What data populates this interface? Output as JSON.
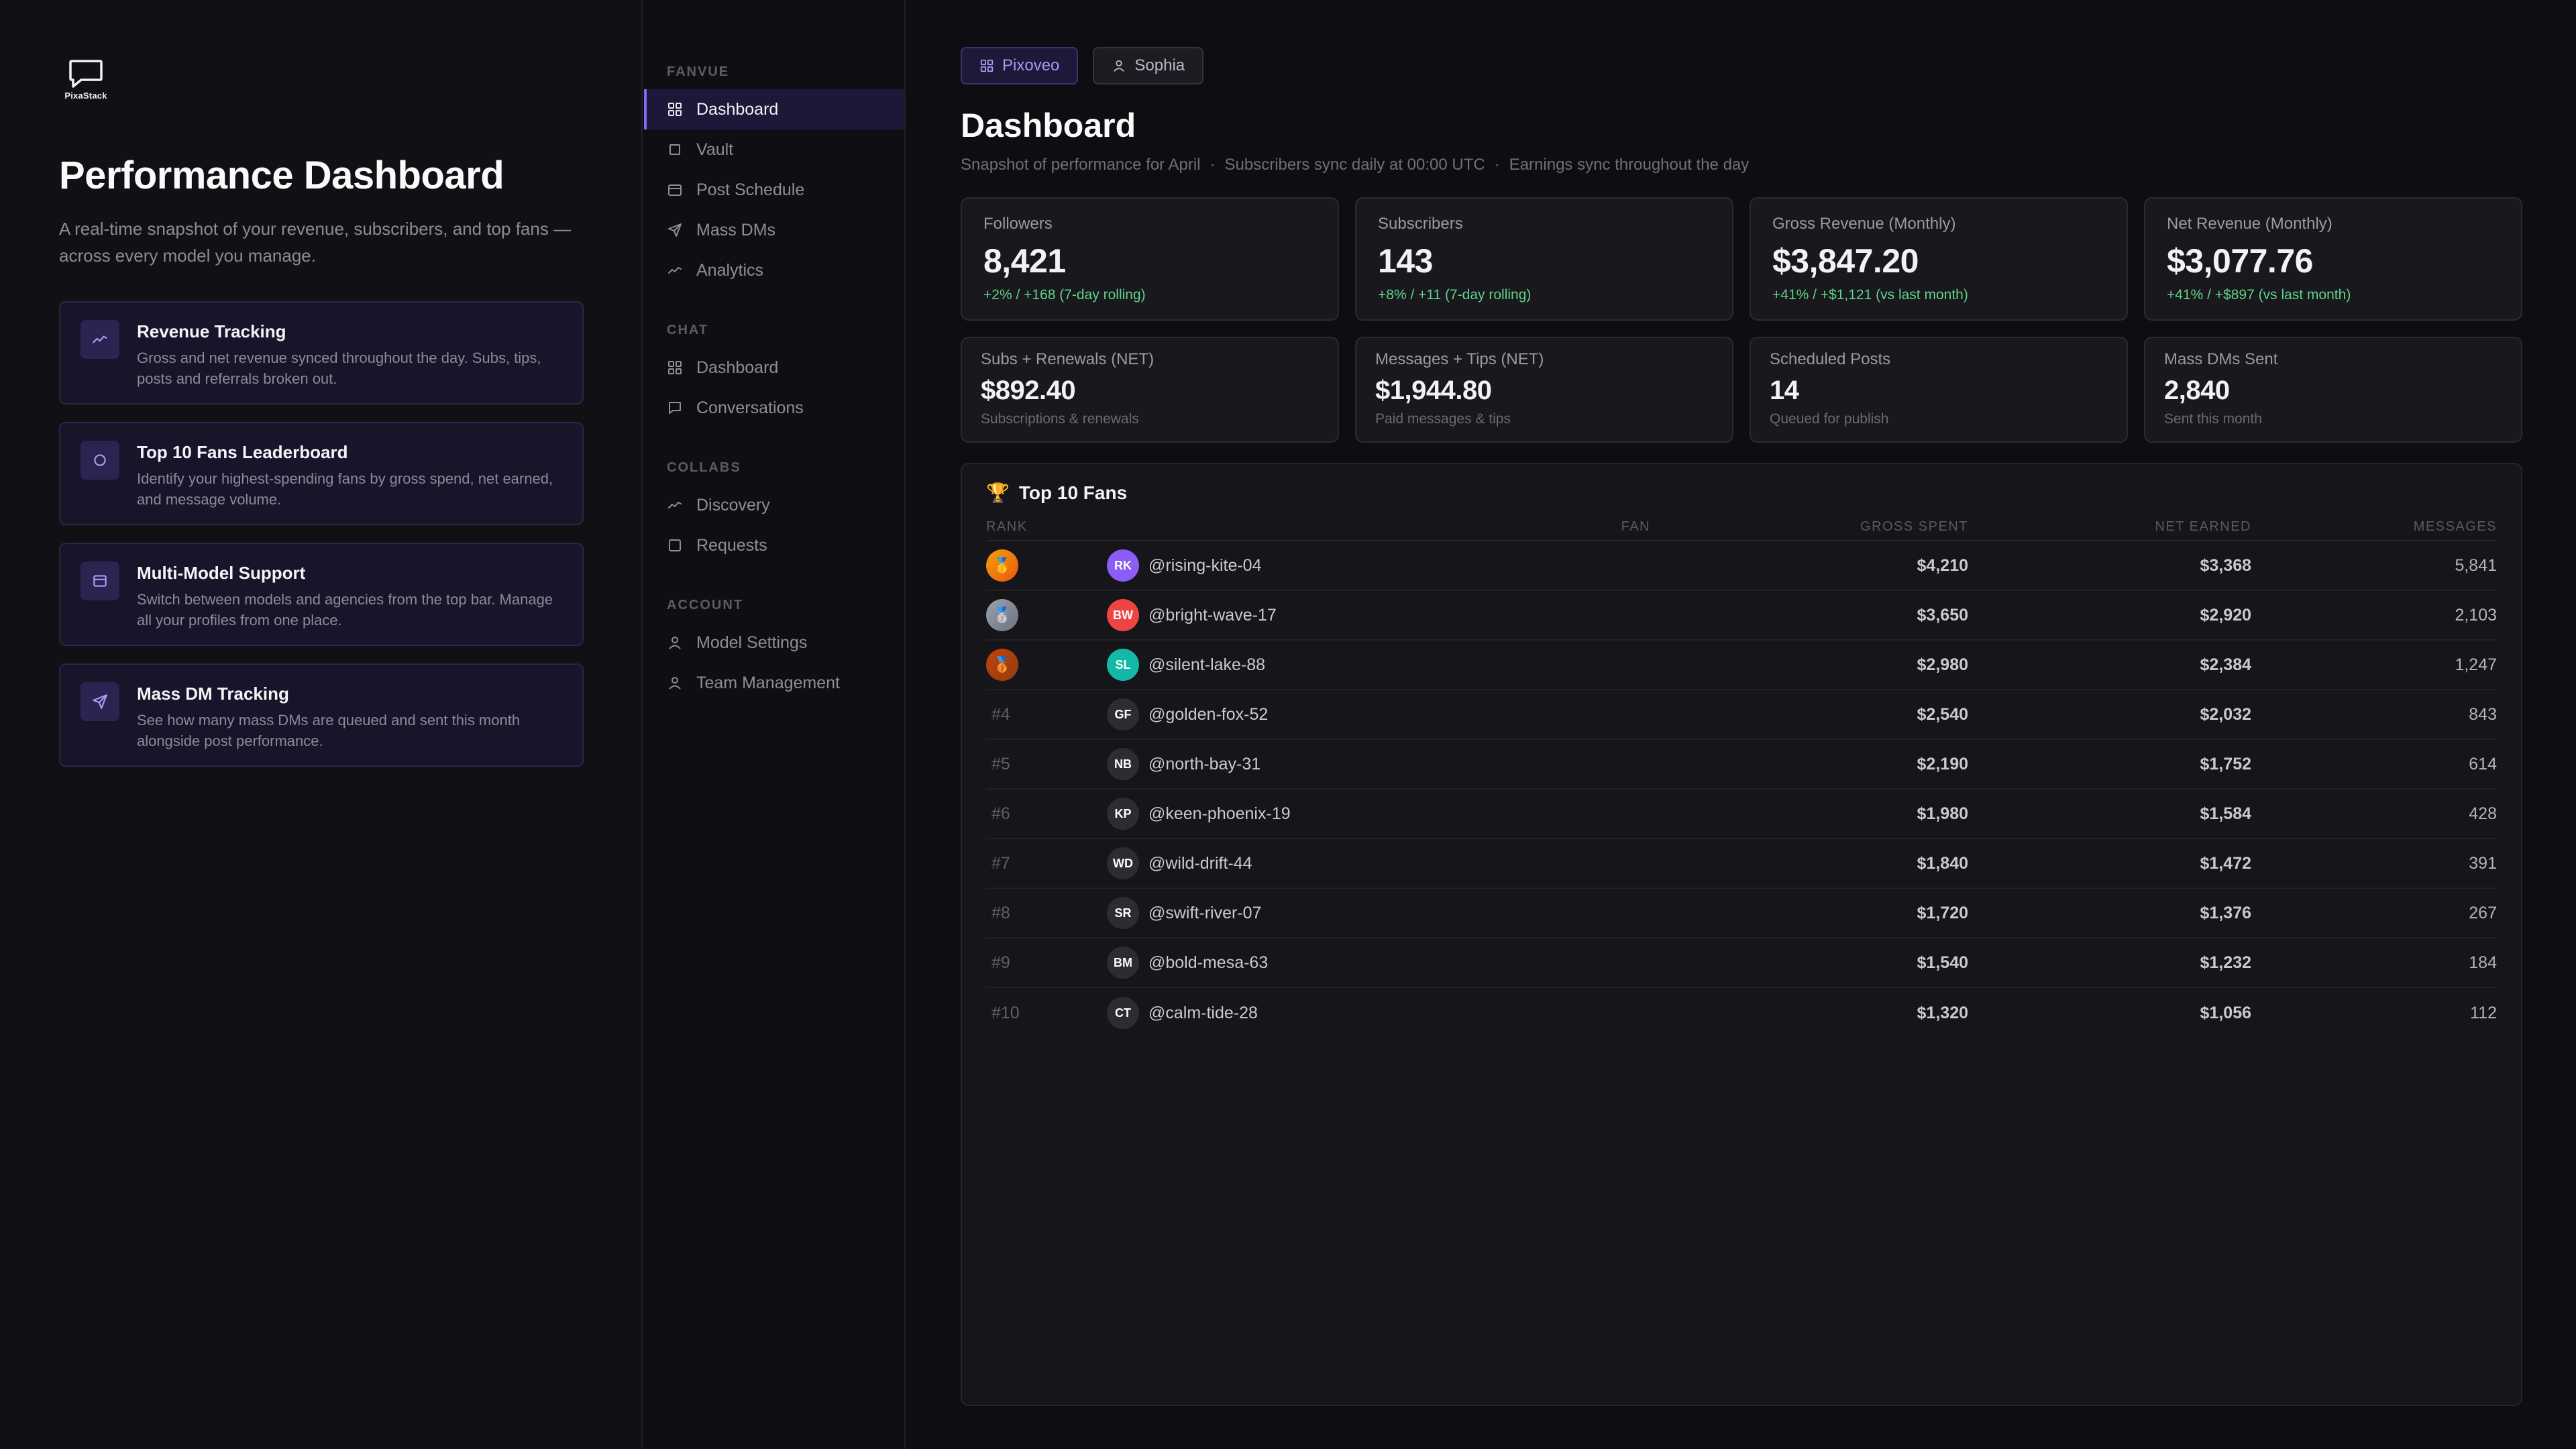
{
  "brand": {
    "name": "PixaStack"
  },
  "intro": {
    "title": "Performance Dashboard",
    "subtitle": "A real-time snapshot of your revenue, subscribers, and top fans — across every model you manage.",
    "features": [
      {
        "icon": "trend-icon",
        "title": "Revenue Tracking",
        "desc": "Gross and net revenue synced throughout the day. Subs, tips, posts and referrals broken out."
      },
      {
        "icon": "circle-icon",
        "title": "Top 10 Fans Leaderboard",
        "desc": "Identify your highest-spending fans by gross spend, net earned, and message volume."
      },
      {
        "icon": "window-icon",
        "title": "Multi-Model Support",
        "desc": "Switch between models and agencies from the top bar. Manage all your profiles from one place."
      },
      {
        "icon": "send-icon",
        "title": "Mass DM Tracking",
        "desc": "See how many mass DMs are queued and sent this month alongside post performance."
      }
    ]
  },
  "sidebar": {
    "sections": [
      {
        "heading": "FANVUE",
        "items": [
          {
            "label": "Dashboard",
            "icon": "grid-icon",
            "active": true
          },
          {
            "label": "Vault",
            "icon": "square-icon"
          },
          {
            "label": "Post Schedule",
            "icon": "calendar-icon"
          },
          {
            "label": "Mass DMs",
            "icon": "send-icon"
          },
          {
            "label": "Analytics",
            "icon": "trend-icon"
          }
        ]
      },
      {
        "heading": "CHAT",
        "items": [
          {
            "label": "Dashboard",
            "icon": "grid-icon"
          },
          {
            "label": "Conversations",
            "icon": "chat-icon"
          }
        ]
      },
      {
        "heading": "COLLABS",
        "items": [
          {
            "label": "Discovery",
            "icon": "trend-icon"
          },
          {
            "label": "Requests",
            "icon": "square-icon"
          }
        ]
      },
      {
        "heading": "ACCOUNT",
        "items": [
          {
            "label": "Model Settings",
            "icon": "user-icon"
          },
          {
            "label": "Team Management",
            "icon": "user-icon"
          }
        ]
      }
    ]
  },
  "topbar": {
    "org_label": "Pixoveo",
    "user_label": "Sophia"
  },
  "header": {
    "title": "Dashboard",
    "sub_1": "Snapshot of performance for April",
    "sub_2": "Subscribers sync daily at 00:00 UTC",
    "sub_3": "Earnings sync throughout the day",
    "separator": "·"
  },
  "stats_primary": [
    {
      "label": "Followers",
      "value": "8,421",
      "delta": "+2% / +168 (7-day rolling)"
    },
    {
      "label": "Subscribers",
      "value": "143",
      "delta": "+8% / +11 (7-day rolling)"
    },
    {
      "label": "Gross Revenue (Monthly)",
      "value": "$3,847.20",
      "delta": "+41% / +$1,121 (vs last month)"
    },
    {
      "label": "Net Revenue (Monthly)",
      "value": "$3,077.76",
      "delta": "+41% / +$897 (vs last month)"
    }
  ],
  "stats_secondary": [
    {
      "label": "Subs + Renewals (NET)",
      "value": "$892.40",
      "note": "Subscriptions & renewals"
    },
    {
      "label": "Messages + Tips (NET)",
      "value": "$1,944.80",
      "note": "Paid messages & tips"
    },
    {
      "label": "Scheduled Posts",
      "value": "14",
      "note": "Queued for publish"
    },
    {
      "label": "Mass DMs Sent",
      "value": "2,840",
      "note": "Sent this month"
    }
  ],
  "top_fans": {
    "title": "Top 10 Fans",
    "trophy": "🏆",
    "columns": {
      "rank": "RANK",
      "fan": "FAN",
      "gross": "GROSS SPENT",
      "net": "NET EARNED",
      "messages": "MESSAGES"
    },
    "rows": [
      {
        "rank": "#1",
        "medal": "gold",
        "medal_glyph": "🥇",
        "initials": "RK",
        "avatar_color": "#8b5cf6",
        "handle": "@rising-kite-04",
        "gross": "$4,210",
        "net": "$3,368",
        "messages": "5,841"
      },
      {
        "rank": "#2",
        "medal": "silver",
        "medal_glyph": "🥈",
        "initials": "BW",
        "avatar_color": "#ef4444",
        "handle": "@bright-wave-17",
        "gross": "$3,650",
        "net": "$2,920",
        "messages": "2,103"
      },
      {
        "rank": "#3",
        "medal": "bronze",
        "medal_glyph": "🥉",
        "initials": "SL",
        "avatar_color": "#14b8a6",
        "handle": "@silent-lake-88",
        "gross": "$2,980",
        "net": "$2,384",
        "messages": "1,247"
      },
      {
        "rank": "#4",
        "initials": "GF",
        "avatar_color": "#2c2c33",
        "handle": "@golden-fox-52",
        "gross": "$2,540",
        "net": "$2,032",
        "messages": "843"
      },
      {
        "rank": "#5",
        "initials": "NB",
        "avatar_color": "#2c2c33",
        "handle": "@north-bay-31",
        "gross": "$2,190",
        "net": "$1,752",
        "messages": "614"
      },
      {
        "rank": "#6",
        "initials": "KP",
        "avatar_color": "#2c2c33",
        "handle": "@keen-phoenix-19",
        "gross": "$1,980",
        "net": "$1,584",
        "messages": "428"
      },
      {
        "rank": "#7",
        "initials": "WD",
        "avatar_color": "#2c2c33",
        "handle": "@wild-drift-44",
        "gross": "$1,840",
        "net": "$1,472",
        "messages": "391"
      },
      {
        "rank": "#8",
        "initials": "SR",
        "avatar_color": "#2c2c33",
        "handle": "@swift-river-07",
        "gross": "$1,720",
        "net": "$1,376",
        "messages": "267"
      },
      {
        "rank": "#9",
        "initials": "BM",
        "avatar_color": "#2c2c33",
        "handle": "@bold-mesa-63",
        "gross": "$1,540",
        "net": "$1,232",
        "messages": "184"
      },
      {
        "rank": "#10",
        "initials": "CT",
        "avatar_color": "#2c2c33",
        "handle": "@calm-tide-28",
        "gross": "$1,320",
        "net": "$1,056",
        "messages": "112"
      }
    ]
  }
}
